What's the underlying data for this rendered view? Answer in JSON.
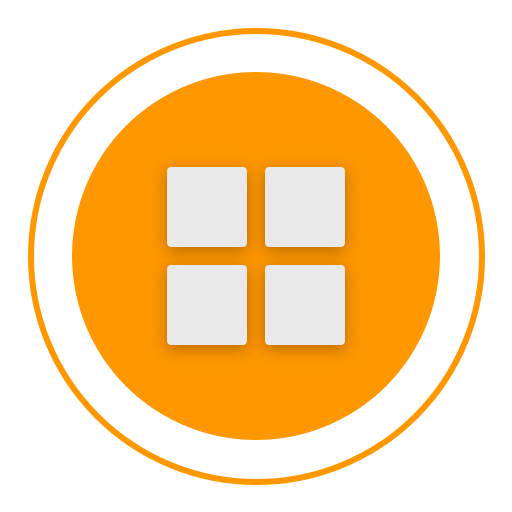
{
  "icon": {
    "name": "app-grid-icon",
    "accent_color": "#ff9800",
    "tile_color": "#e9e9e9",
    "background_color": "#ffffff",
    "tile_count": 4
  }
}
